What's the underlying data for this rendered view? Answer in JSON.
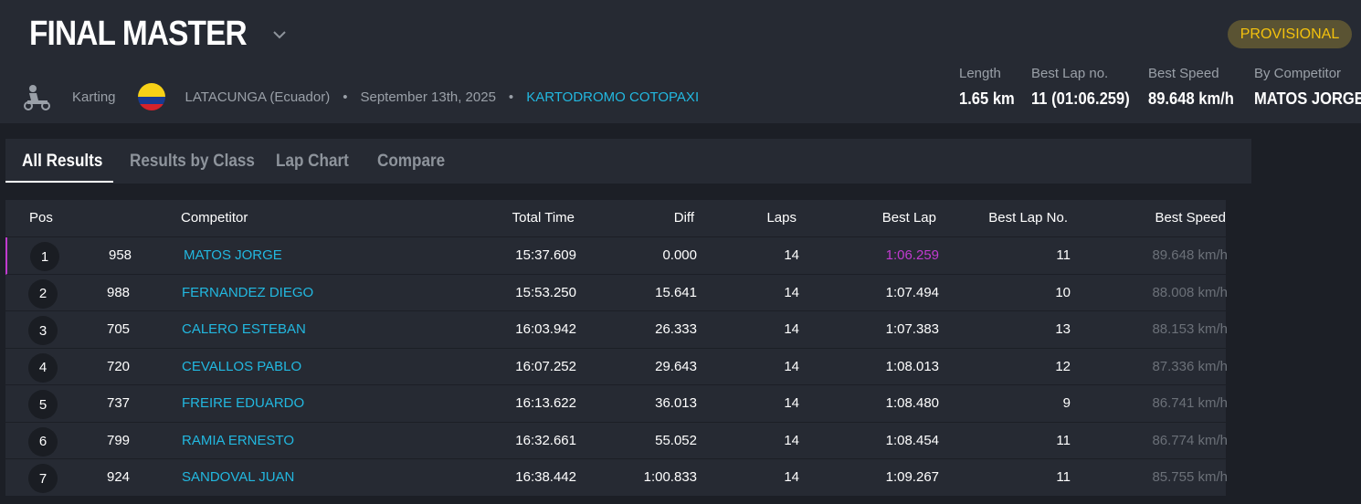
{
  "event": {
    "title": "FINAL MASTER",
    "status_badge": "PROVISIONAL",
    "category": "Karting",
    "location": "LATACUNGA (Ecuador)",
    "date": "September 13th, 2025",
    "track": "KARTODROMO COTOPAXI"
  },
  "stats": {
    "length_label": "Length",
    "length_value": "1.65 km",
    "best_lap_no_label": "Best Lap no.",
    "best_lap_no_value": "11 (01:06.259)",
    "best_speed_label": "Best Speed",
    "best_speed_value": "89.648 km/h",
    "by_competitor_label": "By Competitor",
    "by_competitor_value": "MATOS JORGE"
  },
  "tabs": [
    "All Results",
    "Results by Class",
    "Lap Chart",
    "Compare"
  ],
  "columns": {
    "pos": "Pos",
    "competitor": "Competitor",
    "total_time": "Total Time",
    "diff": "Diff",
    "laps": "Laps",
    "best_lap": "Best Lap",
    "best_lap_no": "Best Lap No.",
    "best_speed": "Best Speed"
  },
  "rows": [
    {
      "pos": "1",
      "num": "958",
      "name": "MATOS JORGE",
      "total": "15:37.609",
      "diff": "0.000",
      "laps": "14",
      "best_lap": "1:06.259",
      "best_lap_no": "11",
      "speed": "89.648 km/h"
    },
    {
      "pos": "2",
      "num": "988",
      "name": "FERNANDEZ DIEGO",
      "total": "15:53.250",
      "diff": "15.641",
      "laps": "14",
      "best_lap": "1:07.494",
      "best_lap_no": "10",
      "speed": "88.008 km/h"
    },
    {
      "pos": "3",
      "num": "705",
      "name": "CALERO ESTEBAN",
      "total": "16:03.942",
      "diff": "26.333",
      "laps": "14",
      "best_lap": "1:07.383",
      "best_lap_no": "13",
      "speed": "88.153 km/h"
    },
    {
      "pos": "4",
      "num": "720",
      "name": "CEVALLOS PABLO",
      "total": "16:07.252",
      "diff": "29.643",
      "laps": "14",
      "best_lap": "1:08.013",
      "best_lap_no": "12",
      "speed": "87.336 km/h"
    },
    {
      "pos": "5",
      "num": "737",
      "name": "FREIRE EDUARDO",
      "total": "16:13.622",
      "diff": "36.013",
      "laps": "14",
      "best_lap": "1:08.480",
      "best_lap_no": "9",
      "speed": "86.741 km/h"
    },
    {
      "pos": "6",
      "num": "799",
      "name": "RAMIA ERNESTO",
      "total": "16:32.661",
      "diff": "55.052",
      "laps": "14",
      "best_lap": "1:08.454",
      "best_lap_no": "11",
      "speed": "86.774 km/h"
    },
    {
      "pos": "7",
      "num": "924",
      "name": "SANDOVAL JUAN",
      "total": "16:38.442",
      "diff": "1:00.833",
      "laps": "14",
      "best_lap": "1:09.267",
      "best_lap_no": "11",
      "speed": "85.755 km/h"
    }
  ],
  "icons": {
    "title_dropdown": "chevron-down-icon",
    "category": "kart-icon",
    "country_flag": "ecuador-flag-icon"
  },
  "colors": {
    "accent_link": "#22b8e0",
    "badge_text": "#f4c20d",
    "fastest_lap": "#c13bd0"
  }
}
